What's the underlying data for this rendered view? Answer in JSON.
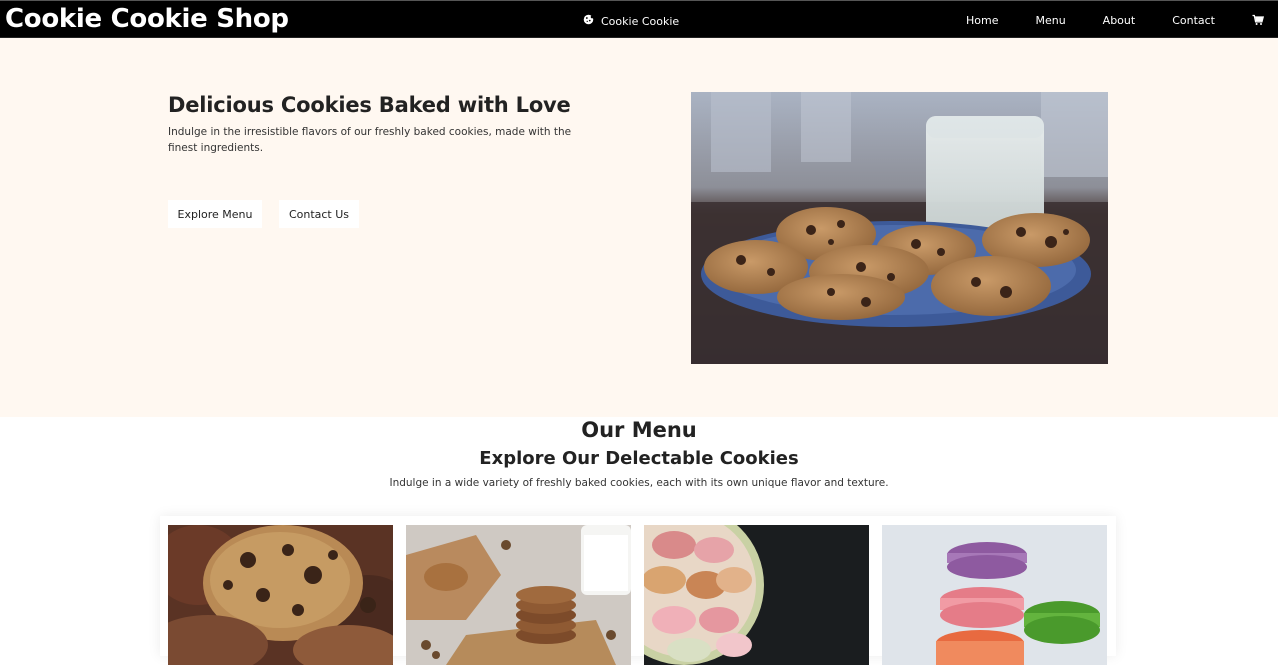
{
  "header": {
    "brand": "Cookie Cookie Shop",
    "center_brand": "Cookie Cookie",
    "center_icon": "cookie-icon",
    "nav": [
      "Home",
      "Menu",
      "About",
      "Contact"
    ],
    "cart_icon": "cart-icon"
  },
  "hero": {
    "title": "Delicious Cookies Baked with Love",
    "description": "Indulge in the irresistible flavors of our freshly baked cookies, made with the finest ingredients.",
    "buttons": {
      "explore": "Explore Menu",
      "contact": "Contact Us"
    }
  },
  "menu": {
    "heading": "Our Menu",
    "subheading": "Explore Our Delectable Cookies",
    "description": "Indulge in a wide variety of freshly baked cookies, each with its own unique flavor and texture."
  },
  "colors": {
    "topbar": "#000000",
    "hero_bg": "#fff8f1",
    "text": "#222222"
  }
}
